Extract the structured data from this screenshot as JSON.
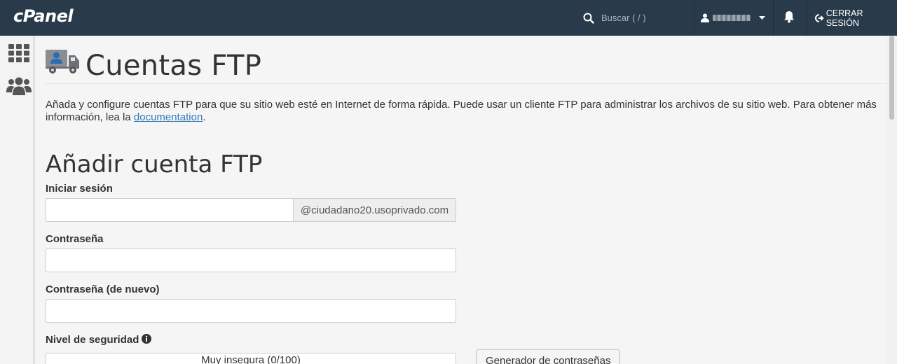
{
  "header": {
    "logo": "cPanel",
    "search_placeholder": "Buscar ( / )",
    "logout_label": "CERRAR SESIÓN"
  },
  "page": {
    "title": "Cuentas FTP",
    "description": "Añada y configure cuentas FTP para que su sitio web esté en Internet de forma rápida. Puede usar un cliente FTP para administrar los archivos de su sitio web. Para obtener más información, lea la ",
    "doc_link": "documentation",
    "description_end": "."
  },
  "form": {
    "section_title": "Añadir cuenta FTP",
    "login_label": "Iniciar sesión",
    "login_value": "",
    "domain_suffix": "@ciudadano20.usoprivado.com",
    "password_label": "Contraseña",
    "password_value": "",
    "password_again_label": "Contraseña (de nuevo)",
    "password_again_value": "",
    "strength_label": "Nivel de seguridad",
    "strength_text": "Muy insegura (0/100)",
    "strength_value": 0,
    "generator_button": "Generador de contraseñas"
  },
  "colors": {
    "topbar": "#293a4a",
    "link": "#337ab7"
  },
  "icons": {
    "search": "search-icon",
    "user": "user-icon",
    "bell": "bell-icon",
    "logout": "logout-icon",
    "apps": "grid-icon",
    "users": "users-icon",
    "page": "truck-icon",
    "info": "info-icon"
  }
}
